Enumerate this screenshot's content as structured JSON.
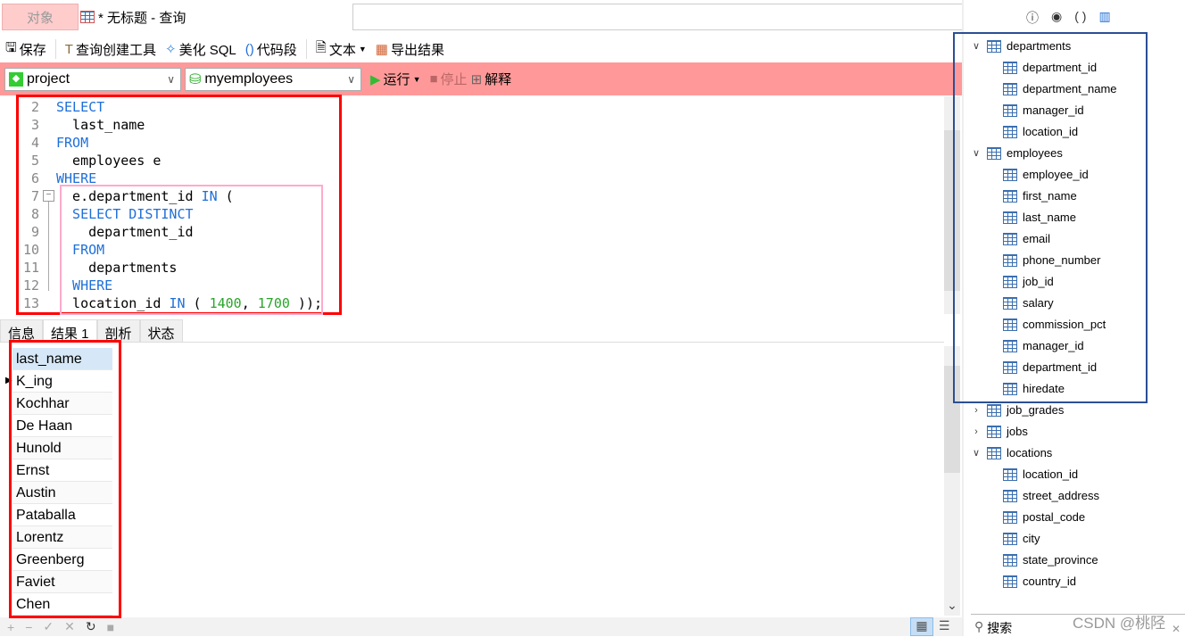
{
  "tabs": {
    "objects": "对象",
    "query": "* 无标题 - 查询"
  },
  "toolbar": {
    "save": "保存",
    "query_builder": "查询创建工具",
    "beautify": "美化 SQL",
    "snippet": "代码段",
    "text": "文本",
    "export": "导出结果"
  },
  "runbar": {
    "connection": "project",
    "database": "myemployees",
    "run": "运行",
    "stop": "停止",
    "explain": "解释"
  },
  "editor": {
    "lines": [
      {
        "n": "2",
        "parts": [
          [
            "kw",
            "SELECT"
          ]
        ]
      },
      {
        "n": "3",
        "parts": [
          [
            "",
            "  last_name"
          ]
        ]
      },
      {
        "n": "4",
        "parts": [
          [
            "kw",
            "FROM"
          ]
        ]
      },
      {
        "n": "5",
        "parts": [
          [
            "",
            "  employees e"
          ]
        ]
      },
      {
        "n": "6",
        "parts": [
          [
            "kw",
            "WHERE"
          ]
        ]
      },
      {
        "n": "7",
        "parts": [
          [
            "",
            "  e.department_id "
          ],
          [
            "kw",
            "IN"
          ],
          [
            "",
            " ("
          ]
        ]
      },
      {
        "n": "8",
        "parts": [
          [
            "kw",
            "  SELECT DISTINCT"
          ]
        ]
      },
      {
        "n": "9",
        "parts": [
          [
            "",
            "    department_id"
          ]
        ]
      },
      {
        "n": "10",
        "parts": [
          [
            "kw",
            "  FROM"
          ]
        ]
      },
      {
        "n": "11",
        "parts": [
          [
            "",
            "    departments"
          ]
        ]
      },
      {
        "n": "12",
        "parts": [
          [
            "kw",
            "  WHERE"
          ]
        ]
      },
      {
        "n": "13",
        "parts": [
          [
            "",
            "  location_id "
          ],
          [
            "kw",
            "IN"
          ],
          [
            "",
            " ( "
          ],
          [
            "num",
            "1400"
          ],
          [
            "",
            ", "
          ],
          [
            "num",
            "1700"
          ],
          [
            "",
            " ));"
          ]
        ]
      }
    ]
  },
  "result_tabs": [
    "信息",
    "结果 1",
    "剖析",
    "状态"
  ],
  "grid": {
    "column": "last_name",
    "rows": [
      "K_ing",
      "Kochhar",
      "De Haan",
      "Hunold",
      "Ernst",
      "Austin",
      "Pataballa",
      "Lorentz",
      "Greenberg",
      "Faviet",
      "Chen"
    ]
  },
  "tree": [
    {
      "name": "departments",
      "expanded": true,
      "columns": [
        "department_id",
        "department_name",
        "manager_id",
        "location_id"
      ]
    },
    {
      "name": "employees",
      "expanded": true,
      "columns": [
        "employee_id",
        "first_name",
        "last_name",
        "email",
        "phone_number",
        "job_id",
        "salary",
        "commission_pct",
        "manager_id",
        "department_id",
        "hiredate"
      ]
    },
    {
      "name": "job_grades",
      "expanded": false,
      "columns": []
    },
    {
      "name": "jobs",
      "expanded": false,
      "columns": []
    },
    {
      "name": "locations",
      "expanded": true,
      "columns": [
        "location_id",
        "street_address",
        "postal_code",
        "city",
        "state_province",
        "country_id"
      ]
    }
  ],
  "search": {
    "placeholder": "搜索"
  },
  "watermark": "CSDN @桃陉",
  "colors": {
    "highlight_red": "#ff0000",
    "highlight_pink": "#ffaacc",
    "highlight_blue": "#2b4f94",
    "runbar": "#ff9999"
  }
}
